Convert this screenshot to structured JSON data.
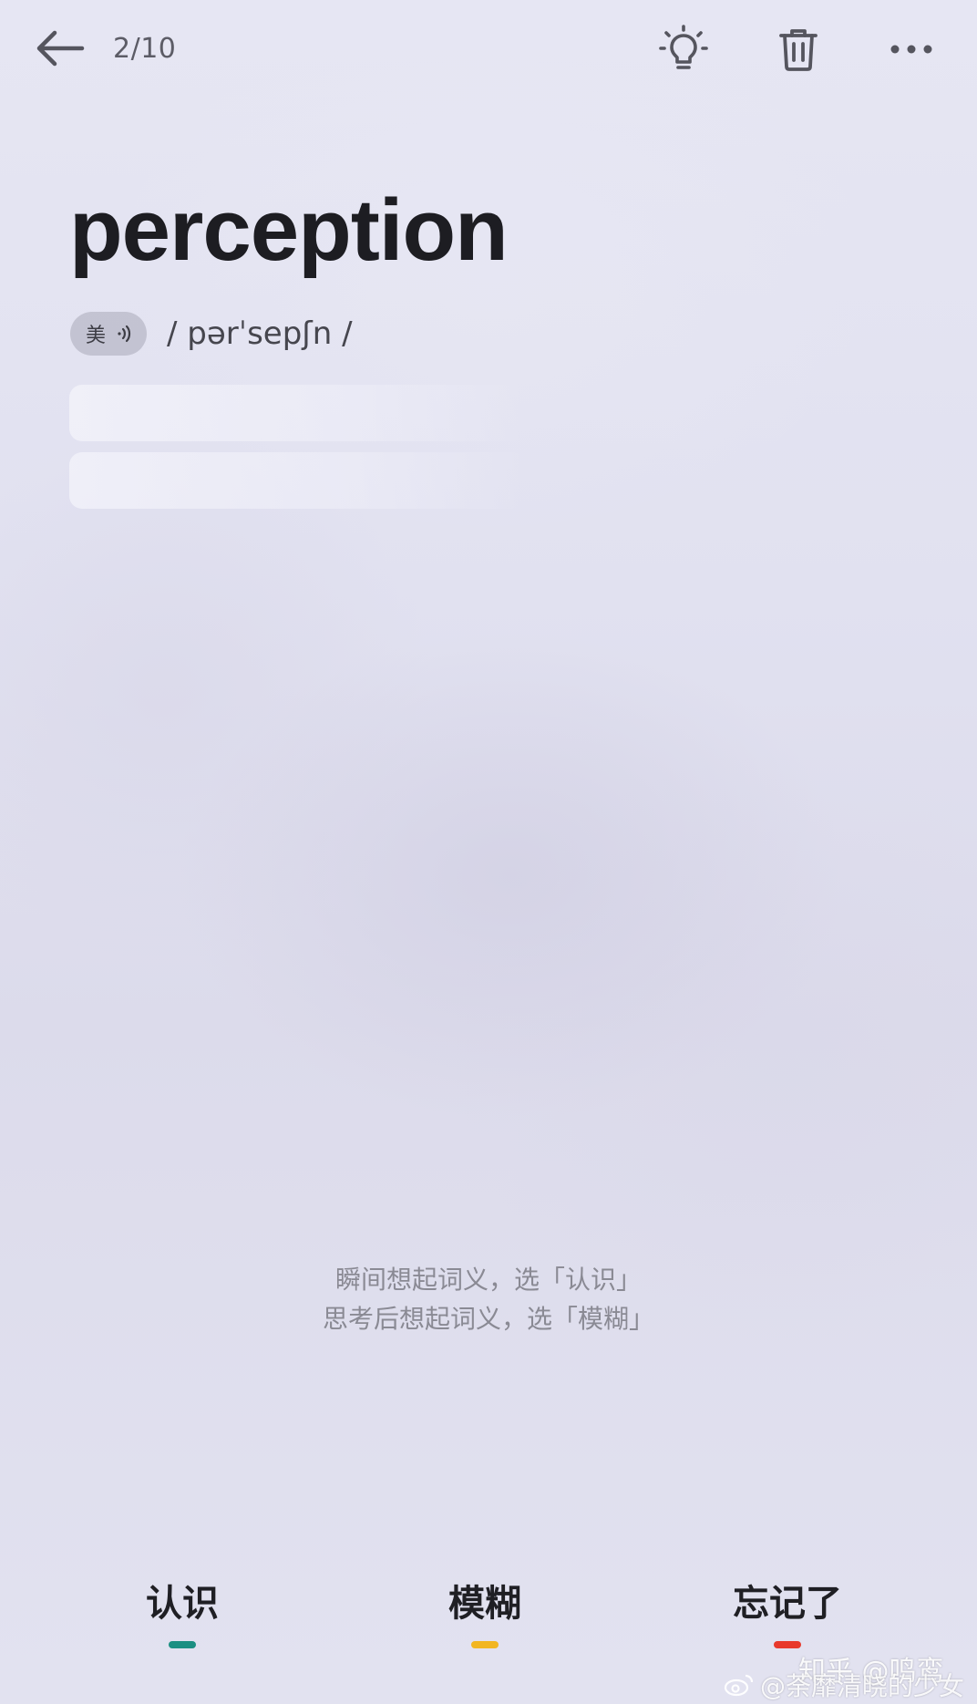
{
  "header": {
    "progress": "2/10",
    "icons": {
      "back": "arrow-left-icon",
      "hint": "lightbulb-icon",
      "delete": "trash-icon",
      "more": "more-horizontal-icon"
    }
  },
  "word": {
    "text": "perception",
    "accent_label": "美",
    "speaker_icon": "speaker-icon",
    "phonetic": "/ pərˈsepʃn /"
  },
  "instructions": {
    "line1": "瞬间想起词义，选「认识」",
    "line2": "思考后想起词义，选「模糊」"
  },
  "choices": {
    "know": {
      "label": "认识",
      "color": "#1b8f82"
    },
    "vague": {
      "label": "模糊",
      "color": "#f2b622"
    },
    "forgot": {
      "label": "忘记了",
      "color": "#e8392c"
    }
  },
  "watermarks": {
    "zhihu": "知乎 @鸣鸾",
    "weibo": "@荼靡清晓的少女"
  },
  "colors": {
    "background": "#e2e2f0",
    "text_primary": "#1d1d22",
    "text_secondary": "#8a8a94"
  }
}
